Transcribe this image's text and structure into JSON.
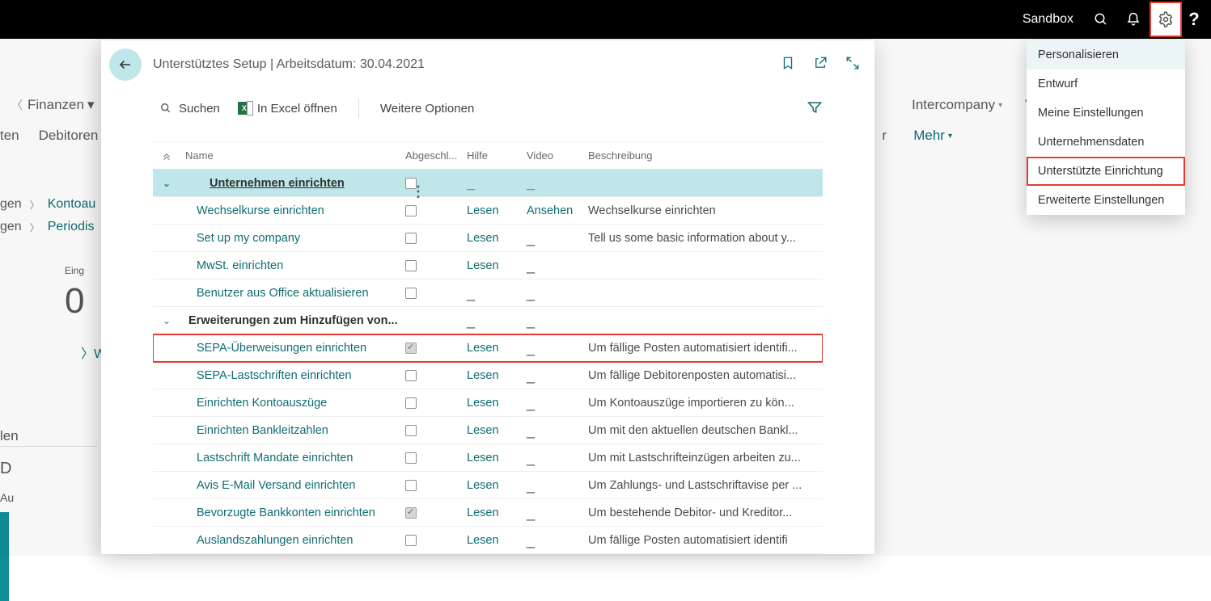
{
  "appbar": {
    "env_label": "Sandbox",
    "help_label": "?"
  },
  "bg": {
    "finanzen": "Finanzen",
    "nav_partial_1": "ten",
    "nav_partial_2": "Debitoren",
    "intercompany": "Intercompany",
    "ve_partial": "Ve",
    "r_partial": "r",
    "mehr": "Mehr",
    "side_line1_a": "gen",
    "side_line1_b": "Kontoau",
    "side_line2_a": "gen",
    "side_line2_b": "Periodis",
    "counter_label": "Eing",
    "counter_zero": "0",
    "w_label": "W",
    "d_label": "D",
    "au_label": "Au",
    "len_label": "len"
  },
  "popup": {
    "title": "Unterstütztes Setup | Arbeitsdatum: 30.04.2021",
    "search_label": "Suchen",
    "excel_label": "In Excel öffnen",
    "more_label": "Weitere Optionen"
  },
  "columns": {
    "name": "Name",
    "abgeschl": "Abgeschl...",
    "hilfe": "Hilfe",
    "video": "Video",
    "beschreibung": "Beschreibung"
  },
  "rows": [
    {
      "type": "header",
      "name": "Unternehmen einrichten",
      "checked": false,
      "hilfe": "",
      "video": "",
      "desc": ""
    },
    {
      "type": "item",
      "name": "Wechselkurse einrichten",
      "checked": false,
      "hilfe": "Lesen",
      "video": "Ansehen",
      "desc": "Wechselkurse einrichten"
    },
    {
      "type": "item",
      "name": "Set up my company",
      "checked": false,
      "hilfe": "Lesen",
      "video": "",
      "desc": "Tell us some basic information about y..."
    },
    {
      "type": "item",
      "name": "MwSt. einrichten",
      "checked": false,
      "hilfe": "Lesen",
      "video": "",
      "desc": ""
    },
    {
      "type": "item",
      "name": "Benutzer aus Office aktualisieren",
      "checked": false,
      "hilfe": "",
      "video": "",
      "desc": ""
    },
    {
      "type": "section",
      "name": "Erweiterungen zum Hinzufügen von...",
      "checked": null,
      "hilfe": "",
      "video": "",
      "desc": ""
    },
    {
      "type": "item",
      "name": "SEPA-Überweisungen einrichten",
      "checked": true,
      "hilfe": "Lesen",
      "video": "",
      "desc": "Um fällige Posten automatisiert identifi...",
      "boxed": true
    },
    {
      "type": "item",
      "name": "SEPA-Lastschriften einrichten",
      "checked": false,
      "hilfe": "Lesen",
      "video": "",
      "desc": "Um fällige Debitorenposten automatisi..."
    },
    {
      "type": "item",
      "name": "Einrichten Kontoauszüge",
      "checked": false,
      "hilfe": "Lesen",
      "video": "",
      "desc": "Um Kontoauszüge importieren zu kön..."
    },
    {
      "type": "item",
      "name": "Einrichten Bankleitzahlen",
      "checked": false,
      "hilfe": "Lesen",
      "video": "",
      "desc": "Um mit den aktuellen deutschen Bankl..."
    },
    {
      "type": "item",
      "name": "Lastschrift Mandate einrichten",
      "checked": false,
      "hilfe": "Lesen",
      "video": "",
      "desc": "Um mit Lastschrifteinzügen arbeiten zu..."
    },
    {
      "type": "item",
      "name": "Avis E-Mail Versand einrichten",
      "checked": false,
      "hilfe": "Lesen",
      "video": "",
      "desc": "Um Zahlungs- und Lastschriftavise per ..."
    },
    {
      "type": "item",
      "name": "Bevorzugte Bankkonten einrichten",
      "checked": true,
      "hilfe": "Lesen",
      "video": "",
      "desc": "Um bestehende Debitor- und Kreditor..."
    },
    {
      "type": "item",
      "name": "Auslandszahlungen einrichten",
      "checked": false,
      "hilfe": "Lesen",
      "video": "",
      "desc": "Um fällige Posten automatisiert identifi"
    }
  ],
  "settings_menu": {
    "items": [
      {
        "label": "Personalisieren",
        "active": true
      },
      {
        "label": "Entwurf"
      },
      {
        "label": "Meine Einstellungen"
      },
      {
        "label": "Unternehmensdaten"
      },
      {
        "label": "Unterstützte Einrichtung",
        "boxed": true
      },
      {
        "label": "Erweiterte Einstellungen"
      }
    ]
  }
}
